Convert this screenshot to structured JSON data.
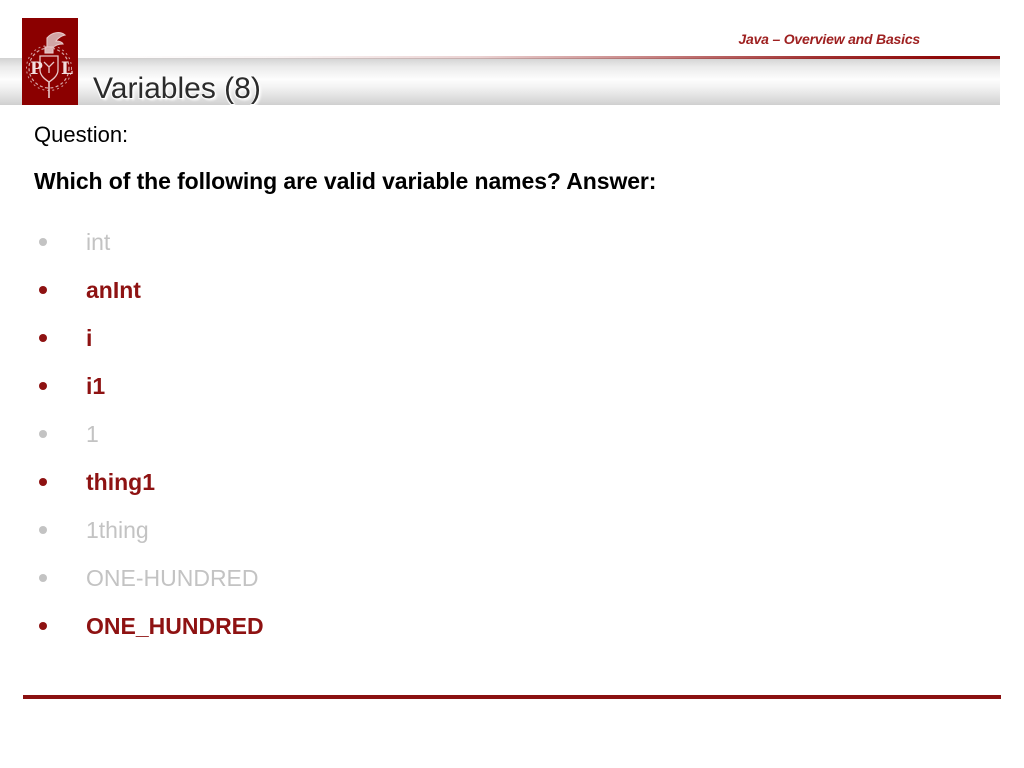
{
  "slide": {
    "header_subtitle": "Java – Overview and Basics",
    "title": "Variables (8)",
    "logo_name": "lodz-university-of-technology-logo",
    "accent_red": "#8b1111",
    "logo_red": "#8b0000",
    "valid_color": "#8e1212",
    "invalid_color": "#c3c3c3"
  },
  "body": {
    "question_label": "Question:",
    "question_text": "Which of the following are valid variable names? Answer:",
    "items": [
      {
        "name": "int",
        "state": "invalid"
      },
      {
        "name": "anInt",
        "state": "valid"
      },
      {
        "name": "i",
        "state": "valid"
      },
      {
        "name": "i1",
        "state": "valid"
      },
      {
        "name": "1",
        "state": "invalid"
      },
      {
        "name": "thing1",
        "state": "valid"
      },
      {
        "name": "1thing",
        "state": "invalid"
      },
      {
        "name": "ONE-HUNDRED",
        "state": "invalid"
      },
      {
        "name": "ONE_HUNDRED",
        "state": "valid"
      }
    ]
  }
}
